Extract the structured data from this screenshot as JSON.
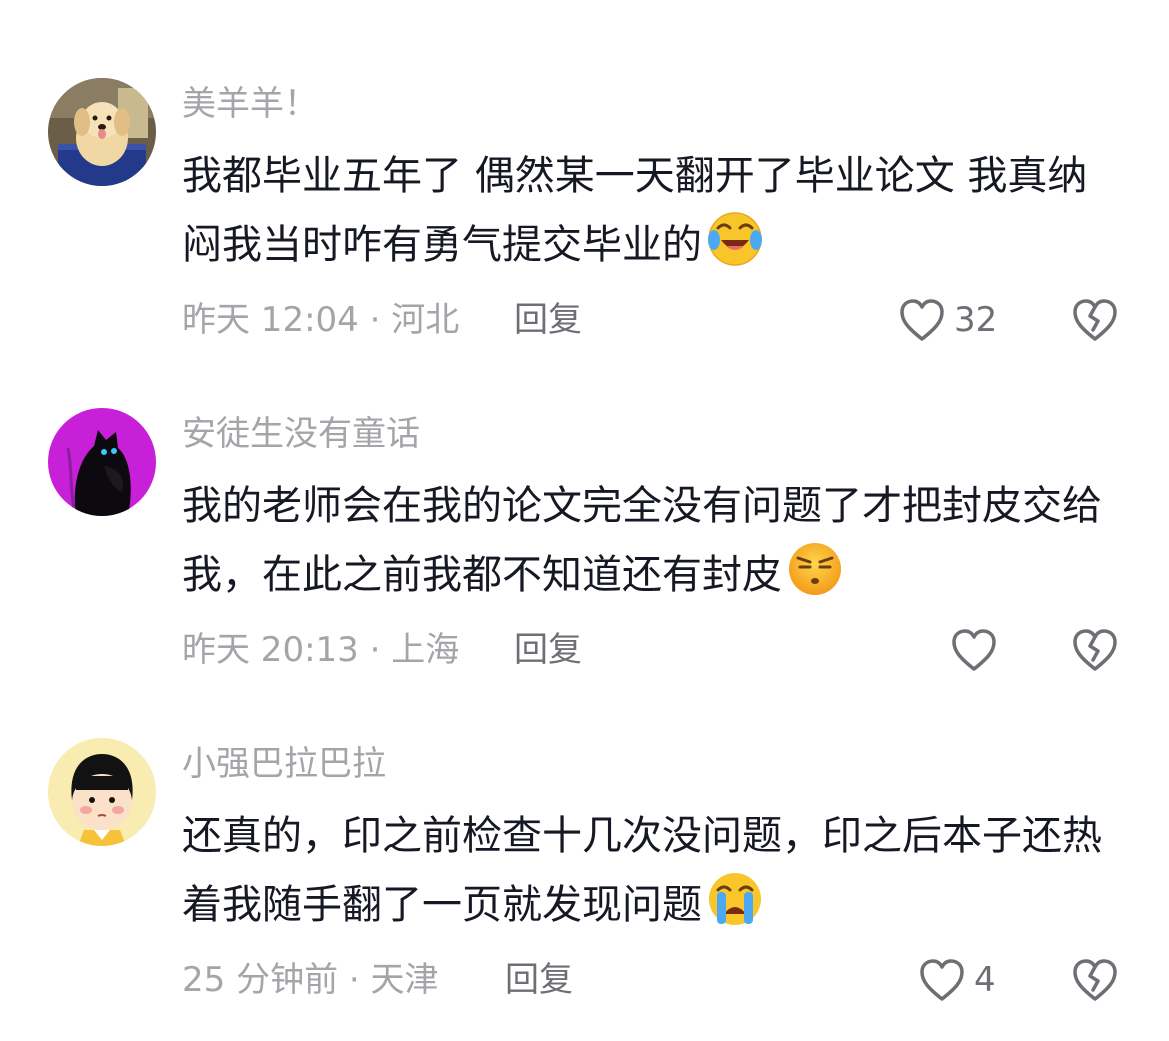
{
  "comments": [
    {
      "avatar_icon": "puppy-avatar",
      "username": "美羊羊！",
      "text": "我都毕业五年了 偶然某一天翻开了毕业论文 我真纳闷我当时咋有勇气提交毕业的",
      "emoji": "crying-laughing-emoji",
      "time": "昨天 12:04",
      "location": "河北",
      "meta": "昨天 12:04 · 河北",
      "reply_label": "回复",
      "like_count": "32",
      "like_icon": "heart-outline-icon",
      "dislike_icon": "broken-heart-icon"
    },
    {
      "avatar_icon": "black-cat-purple-avatar",
      "username": "安徒生没有童话",
      "text": "我的老师会在我的论文完全没有问题了才把封皮交给我，在此之前我都不知道还有封皮",
      "emoji": "skeptical-face-emoji",
      "time": "昨天 20:13",
      "location": "上海",
      "meta": "昨天 20:13 · 上海",
      "reply_label": "回复",
      "like_count": "",
      "like_icon": "heart-outline-icon",
      "dislike_icon": "broken-heart-icon"
    },
    {
      "avatar_icon": "cartoon-girl-avatar",
      "username": "小强巴拉巴拉",
      "text": "还真的，印之前检查十几次没问题，印之后本子还热着我随手翻了一页就发现问题",
      "emoji": "crying-face-emoji",
      "time": "25 分钟前",
      "location": "天津",
      "meta": "25 分钟前 · 天津",
      "reply_label": "回复",
      "like_count": "4",
      "like_icon": "heart-outline-icon",
      "dislike_icon": "broken-heart-icon"
    }
  ]
}
